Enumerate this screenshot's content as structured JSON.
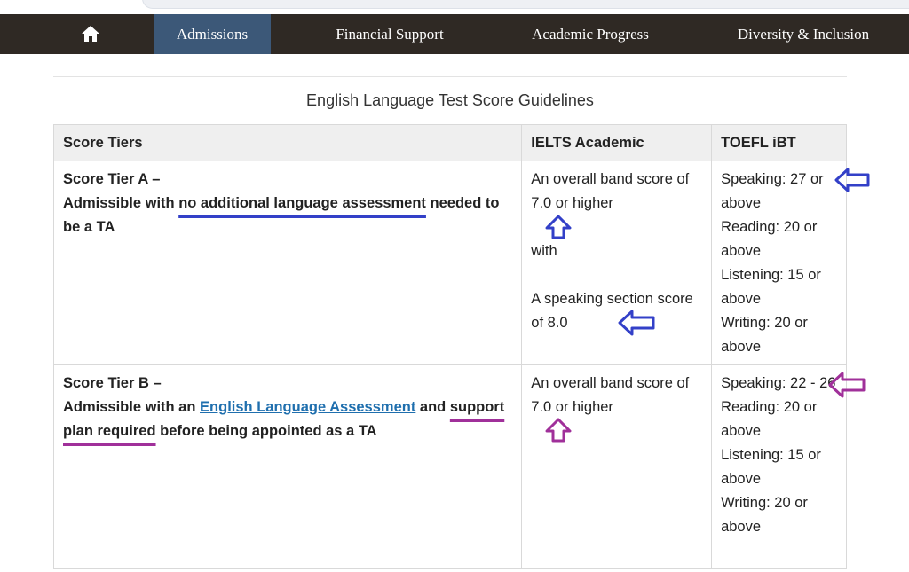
{
  "nav": {
    "home_icon": "home-icon",
    "items": [
      "Admissions",
      "Financial Support",
      "Academic Progress",
      "Diversity & Inclusion"
    ],
    "active": "Admissions",
    "colors": {
      "bar": "#2f2924",
      "active": "#3c5878"
    }
  },
  "table": {
    "caption": "English Language Test Score Guidelines",
    "headers": [
      "Score Tiers",
      "IELTS Academic",
      "TOEFL iBT"
    ],
    "rows": [
      {
        "tier_title": "Score Tier A –",
        "tier_pre": "Admissible with ",
        "tier_highlight": "no additional language assessment",
        "tier_post": " needed to be a TA",
        "ielts_line1": "An overall band score of 7.0 or higher",
        "ielts_with": "with",
        "ielts_line2": "A speaking section score of 8.0",
        "toefl": [
          "Speaking: 27 or above",
          "Reading: 20 or above",
          "Listening: 15 or above",
          "Writing: 20 or above"
        ]
      },
      {
        "tier_title": "Score Tier B –",
        "tier_pre": "Admissible with an ",
        "tier_link": "English Language Assessment",
        "tier_mid": " and ",
        "tier_highlight": "support plan required",
        "tier_post": " before being appointed as a TA",
        "ielts_line1": "An overall band score of 7.0 or higher",
        "toefl": [
          "Speaking: 22 - 26",
          "Reading: 20 or above",
          "Listening: 15 or above",
          "Writing: 20 or above"
        ]
      }
    ]
  },
  "annotation_colors": {
    "tier_a": "#3340c8",
    "tier_b": "#a0309a"
  }
}
